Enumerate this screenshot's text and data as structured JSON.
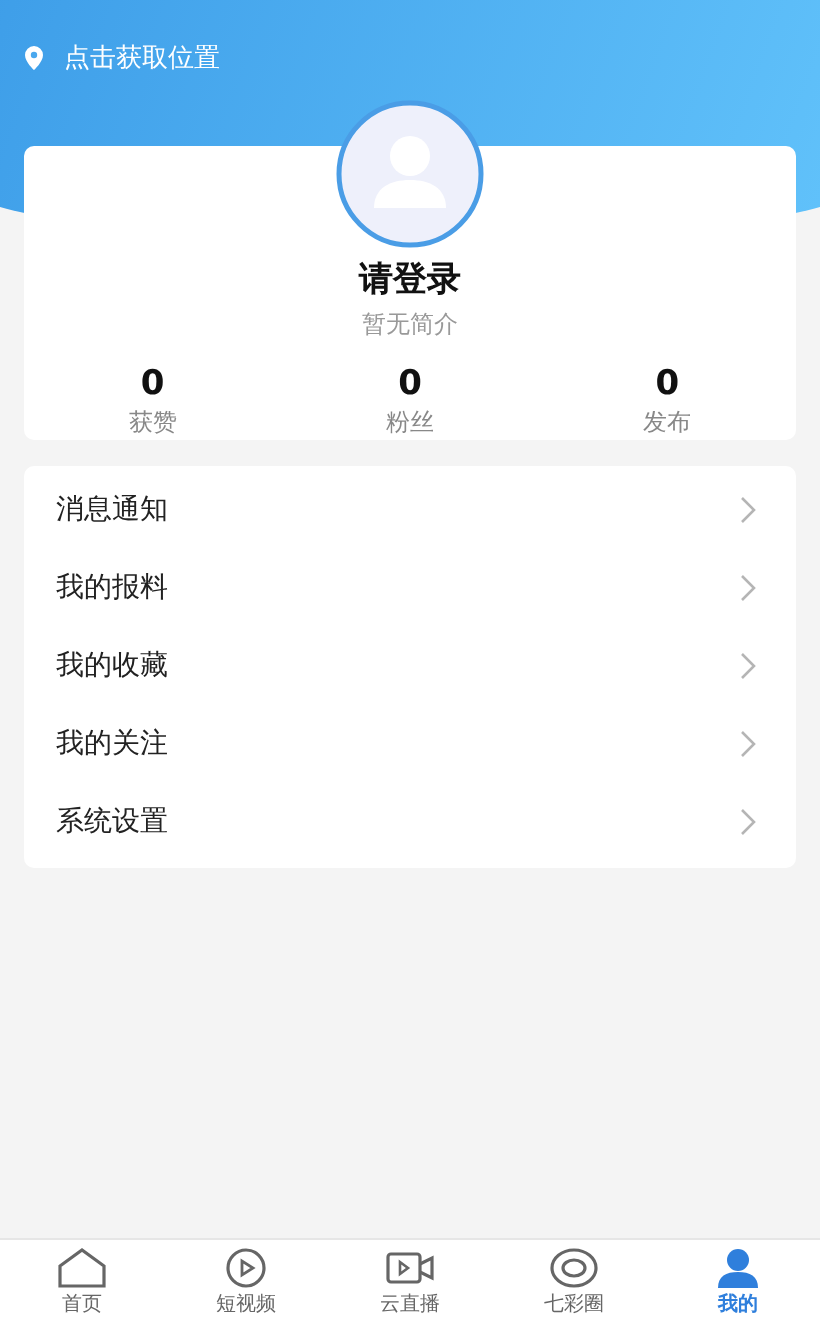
{
  "location": {
    "text": "点击获取位置"
  },
  "profile": {
    "name": "请登录",
    "bio": "暂无简介"
  },
  "stats": [
    {
      "value": "0",
      "label": "获赞"
    },
    {
      "value": "0",
      "label": "粉丝"
    },
    {
      "value": "0",
      "label": "发布"
    }
  ],
  "menu": [
    {
      "label": "消息通知"
    },
    {
      "label": "我的报料"
    },
    {
      "label": "我的收藏"
    },
    {
      "label": "我的关注"
    },
    {
      "label": "系统设置"
    }
  ],
  "tabs": [
    {
      "label": "首页",
      "kind": "home",
      "selected": false
    },
    {
      "label": "短视频",
      "kind": "play",
      "selected": false
    },
    {
      "label": "云直播",
      "kind": "camera",
      "selected": false
    },
    {
      "label": "七彩圈",
      "kind": "ring",
      "selected": false
    },
    {
      "label": "我的",
      "kind": "person",
      "selected": true
    }
  ]
}
